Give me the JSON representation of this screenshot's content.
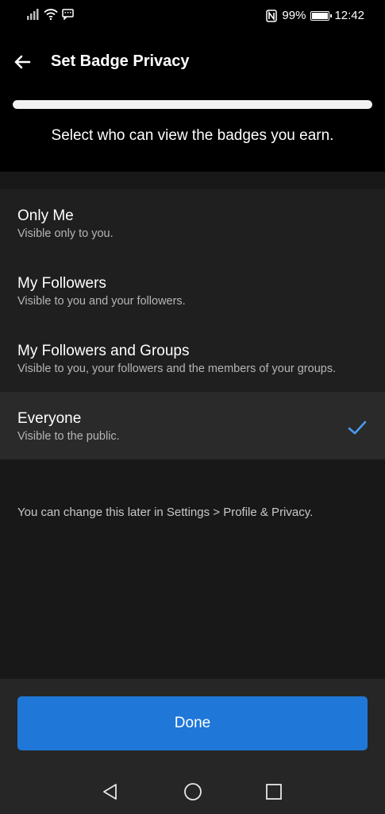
{
  "status_bar": {
    "battery_percent": "99%",
    "battery_level": 0.99,
    "time": "12:42",
    "icons": [
      "signal-icon",
      "wifi-icon",
      "message-icon",
      "nfc-icon",
      "battery-icon"
    ]
  },
  "header": {
    "title": "Set Badge Privacy",
    "back_icon": "arrow-left-icon"
  },
  "progress": {
    "value": 1.0
  },
  "subtitle": "Select who can view the badges you earn.",
  "options": [
    {
      "title": "Only Me",
      "description": "Visible only to you.",
      "selected": false
    },
    {
      "title": "My Followers",
      "description": "Visible to you and your followers.",
      "selected": false
    },
    {
      "title": "My Followers and Groups",
      "description": "Visible to you, your followers and the members of your groups.",
      "selected": false
    },
    {
      "title": "Everyone",
      "description": "Visible to the public.",
      "selected": true
    }
  ],
  "footnote": "You can change this later in Settings > Profile & Privacy.",
  "done_button": {
    "label": "Done"
  },
  "nav": {
    "icons": [
      "back-triangle-icon",
      "home-circle-icon",
      "recents-square-icon"
    ]
  },
  "colors": {
    "accent": "#1f77d8",
    "check": "#4a9bf0",
    "background": "#000000"
  }
}
